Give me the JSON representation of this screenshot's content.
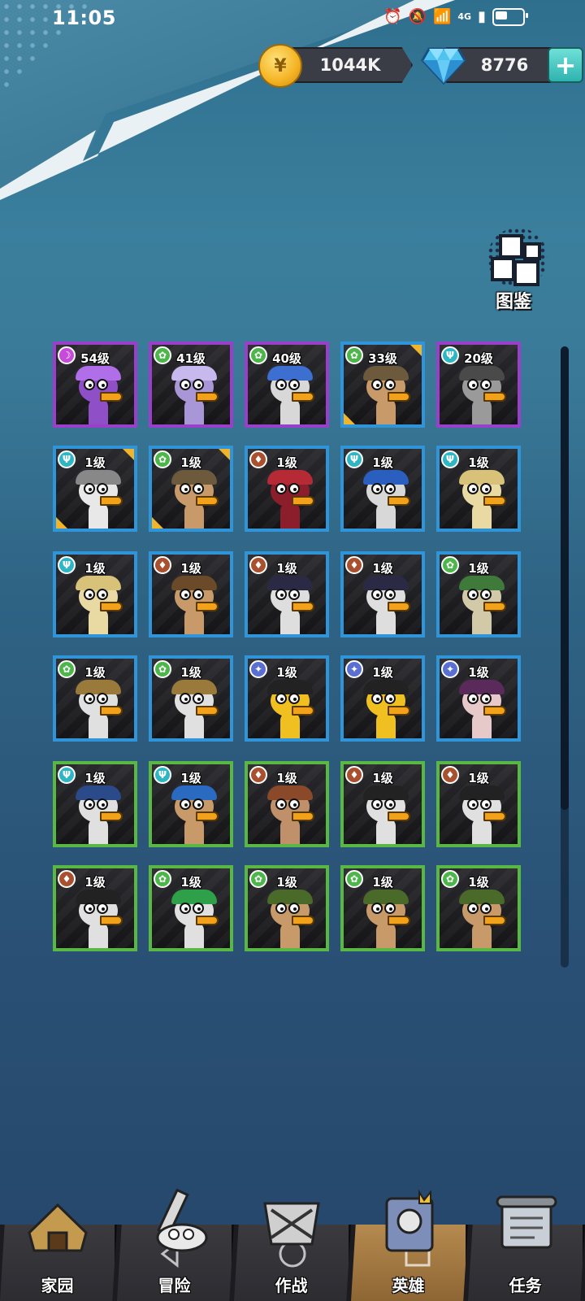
{
  "status_bar": {
    "time": "11:05",
    "network": "4G"
  },
  "currency": {
    "coins": "1044K",
    "gems": "8776",
    "coin_icon": "coin-icon",
    "gem_icon": "diamond-icon",
    "add_icon": "plus-icon"
  },
  "codex": {
    "label": "图鉴"
  },
  "heroes": [
    {
      "level": "54级",
      "rarity": "purple",
      "element": "dark",
      "skin": "#8e4fc7",
      "hat": "#b06ee8",
      "corner": false
    },
    {
      "level": "41级",
      "rarity": "purple",
      "element": "plant",
      "skin": "#a996d6",
      "hat": "#c7b8ee",
      "corner": false
    },
    {
      "level": "40级",
      "rarity": "purple",
      "element": "plant",
      "skin": "#d8d8d8",
      "hat": "#3c6fd0",
      "corner": false
    },
    {
      "level": "33级",
      "rarity": "blue",
      "element": "plant",
      "skin": "#c89a6a",
      "hat": "#6d5a3c",
      "corner": true
    },
    {
      "level": "20级",
      "rarity": "purple",
      "element": "water",
      "skin": "#9a9a9a",
      "hat": "#4a4a4a",
      "corner": false
    },
    {
      "level": "1级",
      "rarity": "blue",
      "element": "water",
      "skin": "#e8e8e8",
      "hat": "#888888",
      "corner": true
    },
    {
      "level": "1级",
      "rarity": "blue",
      "element": "plant",
      "skin": "#c89a6a",
      "hat": "#6d5a3c",
      "corner": true
    },
    {
      "level": "1级",
      "rarity": "blue",
      "element": "fire",
      "skin": "#8b1e2a",
      "hat": "#b52a35",
      "corner": false
    },
    {
      "level": "1级",
      "rarity": "blue",
      "element": "water",
      "skin": "#d8d8d8",
      "hat": "#2a5fbf",
      "corner": false
    },
    {
      "level": "1级",
      "rarity": "blue",
      "element": "water",
      "skin": "#e9d9a2",
      "hat": "#d8c27a",
      "corner": false
    },
    {
      "level": "1级",
      "rarity": "blue",
      "element": "water",
      "skin": "#e9d9a2",
      "hat": "#d8c27a",
      "corner": false
    },
    {
      "level": "1级",
      "rarity": "blue",
      "element": "fire",
      "skin": "#c89a6a",
      "hat": "#6b4a2a",
      "corner": false
    },
    {
      "level": "1级",
      "rarity": "blue",
      "element": "fire",
      "skin": "#dedede",
      "hat": "#2a2a44",
      "corner": false
    },
    {
      "level": "1级",
      "rarity": "blue",
      "element": "fire",
      "skin": "#dedede",
      "hat": "#2a2a44",
      "corner": false
    },
    {
      "level": "1级",
      "rarity": "blue",
      "element": "plant",
      "skin": "#d2c9a8",
      "hat": "#3f7a3a",
      "corner": false
    },
    {
      "level": "1级",
      "rarity": "blue",
      "element": "plant",
      "skin": "#e0e0e0",
      "hat": "#9a7a3a",
      "corner": false
    },
    {
      "level": "1级",
      "rarity": "blue",
      "element": "plant",
      "skin": "#e0e0e0",
      "hat": "#9a7a3a",
      "corner": false
    },
    {
      "level": "1级",
      "rarity": "blue",
      "element": "star",
      "skin": "#f0c020",
      "hat": "#222222",
      "corner": false
    },
    {
      "level": "1级",
      "rarity": "blue",
      "element": "star",
      "skin": "#f0c020",
      "hat": "#222222",
      "corner": false
    },
    {
      "level": "1级",
      "rarity": "blue",
      "element": "star",
      "skin": "#e8c9c9",
      "hat": "#5a2a5a",
      "corner": false
    },
    {
      "level": "1级",
      "rarity": "green",
      "element": "water",
      "skin": "#e0e0e0",
      "hat": "#2a4a8a",
      "corner": false
    },
    {
      "level": "1级",
      "rarity": "green",
      "element": "water",
      "skin": "#c89a6a",
      "hat": "#2a6ac0",
      "corner": false
    },
    {
      "level": "1级",
      "rarity": "green",
      "element": "fire",
      "skin": "#c0906a",
      "hat": "#8a4a2a",
      "corner": false
    },
    {
      "level": "1级",
      "rarity": "green",
      "element": "fire",
      "skin": "#e0e0e0",
      "hat": "#222222",
      "corner": false
    },
    {
      "level": "1级",
      "rarity": "green",
      "element": "fire",
      "skin": "#e0e0e0",
      "hat": "#222222",
      "corner": false
    },
    {
      "level": "1级",
      "rarity": "green",
      "element": "fire",
      "skin": "#e0e0e0",
      "hat": "#222222",
      "corner": false
    },
    {
      "level": "1级",
      "rarity": "green",
      "element": "plant",
      "skin": "#e0e0e0",
      "hat": "#2fa04a",
      "corner": false
    },
    {
      "level": "1级",
      "rarity": "green",
      "element": "plant",
      "skin": "#c89a6a",
      "hat": "#4a6a2a",
      "corner": false
    },
    {
      "level": "1级",
      "rarity": "green",
      "element": "plant",
      "skin": "#c89a6a",
      "hat": "#4a6a2a",
      "corner": false
    },
    {
      "level": "1级",
      "rarity": "green",
      "element": "plant",
      "skin": "#c89a6a",
      "hat": "#4a6a2a",
      "corner": false
    }
  ],
  "nav": {
    "items": [
      {
        "label": "家园",
        "icon": "home-icon",
        "active": false
      },
      {
        "label": "冒险",
        "icon": "adventure-icon",
        "active": false
      },
      {
        "label": "作战",
        "icon": "battle-icon",
        "active": false
      },
      {
        "label": "英雄",
        "icon": "hero-book-icon",
        "active": true
      },
      {
        "label": "任务",
        "icon": "quest-scroll-icon",
        "active": false
      }
    ]
  }
}
